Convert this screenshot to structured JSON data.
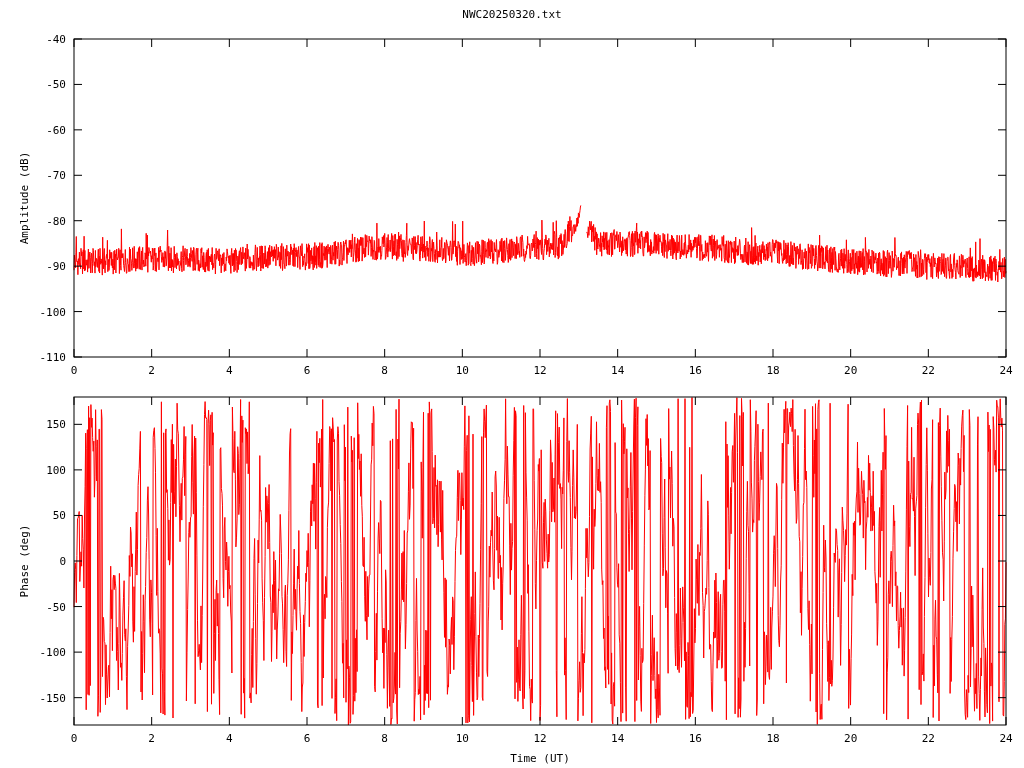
{
  "title": "NWC20250320.txt",
  "charts": [
    {
      "kind": "amplitude",
      "ylabel": "Amplitude (dB)",
      "yticks": [
        "-40",
        "-50",
        "-60",
        "-70",
        "-80",
        "-90",
        "-100",
        "-110"
      ],
      "xticks": [
        "0",
        "2",
        "4",
        "6",
        "8",
        "10",
        "12",
        "14",
        "16",
        "18",
        "20",
        "22",
        "24"
      ]
    },
    {
      "kind": "phase",
      "ylabel": "Phase (deg)",
      "xlabel": "Time (UT)",
      "yticks": [
        "150",
        "100",
        "50",
        "0",
        "-50",
        "-100",
        "-150"
      ],
      "xticks": [
        "0",
        "2",
        "4",
        "6",
        "8",
        "10",
        "12",
        "14",
        "16",
        "18",
        "20",
        "22",
        "24"
      ]
    }
  ]
}
